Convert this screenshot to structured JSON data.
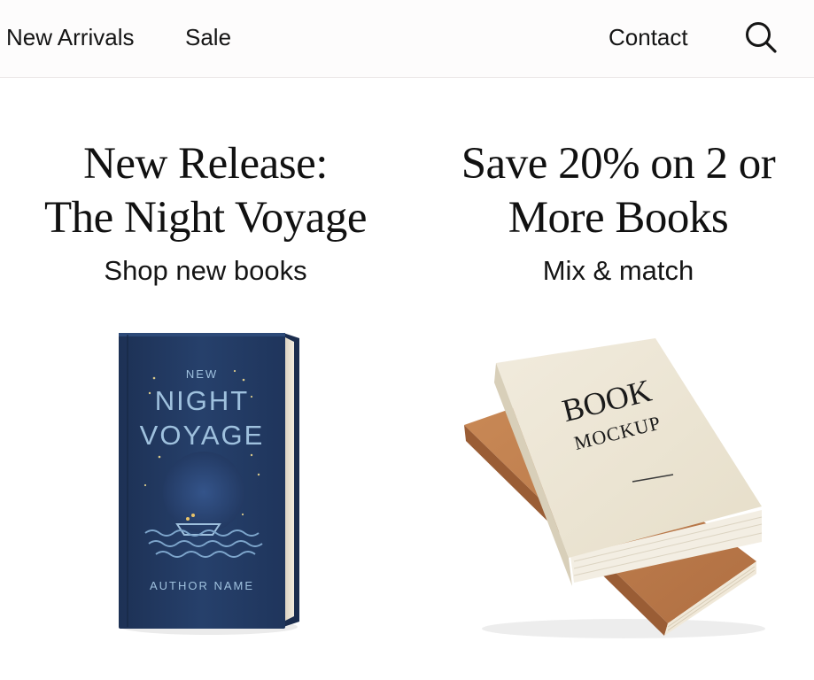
{
  "nav": {
    "links": [
      {
        "label": "New Arrivals"
      },
      {
        "label": "Sale"
      },
      {
        "label": "Contact"
      }
    ],
    "search_icon": "search-icon"
  },
  "promos": [
    {
      "title_line1": "New Release:",
      "title_line2": "The Night Voyage",
      "subtitle": "Shop new books",
      "cover": {
        "tag": "NEW",
        "title_line1": "NIGHT",
        "title_line2": "VOYAGE",
        "author": "AUTHOR NAME",
        "color": "#233a63",
        "text_color": "#9fc1de",
        "accent_color": "#e9c46a"
      }
    },
    {
      "title_line1": "Save 20% on 2 or",
      "title_line2": "More Books",
      "subtitle": "Mix & match",
      "cover": {
        "title_line1": "BOOK",
        "title_line2": "MOCKUP",
        "color": "#ece5d6",
        "under_color": "#c27e4f"
      }
    }
  ]
}
